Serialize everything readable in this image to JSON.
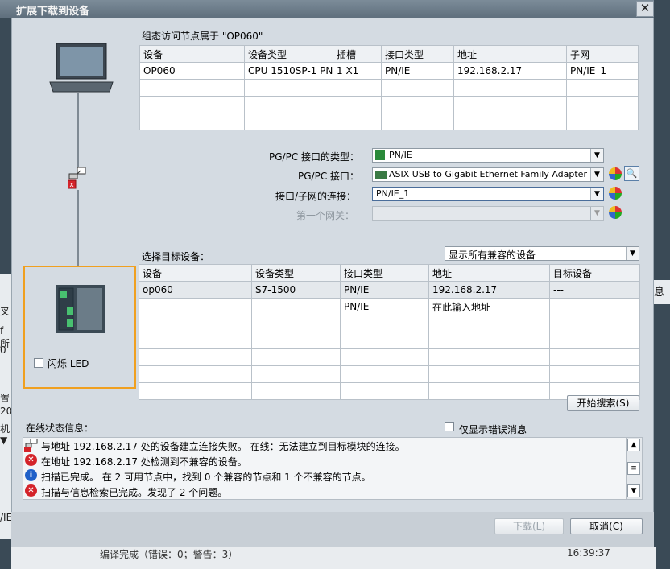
{
  "window": {
    "title": "扩展下载到设备",
    "close_label": "✕"
  },
  "config_table": {
    "caption": "组态访问节点属于 \"OP060\"",
    "headers": [
      "设备",
      "设备类型",
      "插槽",
      "接口类型",
      "地址",
      "子网"
    ],
    "rows": [
      [
        "OP060",
        "CPU 1510SP-1 PN",
        "1 X1",
        "PN/IE",
        "192.168.2.17",
        "PN/IE_1"
      ]
    ]
  },
  "interface": {
    "type_label": "PG/PC 接口的类型：",
    "type_value": "PN/IE",
    "iface_label": "PG/PC 接口：",
    "iface_value": "ASIX USB to Gigabit Ethernet Family Adapter",
    "conn_label": "接口/子网的连接：",
    "conn_value": "PN/IE_1",
    "gateway_label": "第一个网关：",
    "gateway_value": ""
  },
  "target": {
    "label": "选择目标设备：",
    "filter_value": "显示所有兼容的设备",
    "headers": [
      "设备",
      "设备类型",
      "接口类型",
      "地址",
      "目标设备"
    ],
    "rows": [
      [
        "op060",
        "S7-1500",
        "PN/IE",
        "192.168.2.17",
        "---"
      ],
      [
        "---",
        "---",
        "PN/IE",
        "在此输入地址",
        "---"
      ]
    ]
  },
  "flash_led_label": "闪烁 LED",
  "search_button": "开始搜索(S)",
  "status": {
    "label": "在线状态信息：",
    "only_errors_label": "仅显示错误消息",
    "messages": [
      {
        "icon": "network-error-icon",
        "text": "与地址 192.168.2.17 处的设备建立连接失败。 在线：无法建立到目标模块的连接。"
      },
      {
        "icon": "error-icon",
        "text": "在地址 192.168.2.17 处检测到不兼容的设备。"
      },
      {
        "icon": "info-icon",
        "text": "扫描已完成。 在 2 可用节点中，找到 0 个兼容的节点和 1 个不兼容的节点。"
      },
      {
        "icon": "error-icon",
        "text": "扫描与信息检索已完成。发现了 2 个问题。"
      }
    ]
  },
  "buttons": {
    "download": "下载(L)",
    "cancel": "取消(C)"
  },
  "background": {
    "left_chars": [
      "叉",
      "f所",
      "0",
      "置",
      "20",
      "机",
      "▼",
      "/IE_"
    ],
    "right_text": "息",
    "bottom_text": "编译完成（错误：0；警告：3）",
    "bottom_time": "16:39:37"
  },
  "colors": {
    "highlight_border": "#f0a020",
    "pink_cell": "#ecd3dc",
    "error": "#d4232a",
    "info": "#2060c8"
  }
}
